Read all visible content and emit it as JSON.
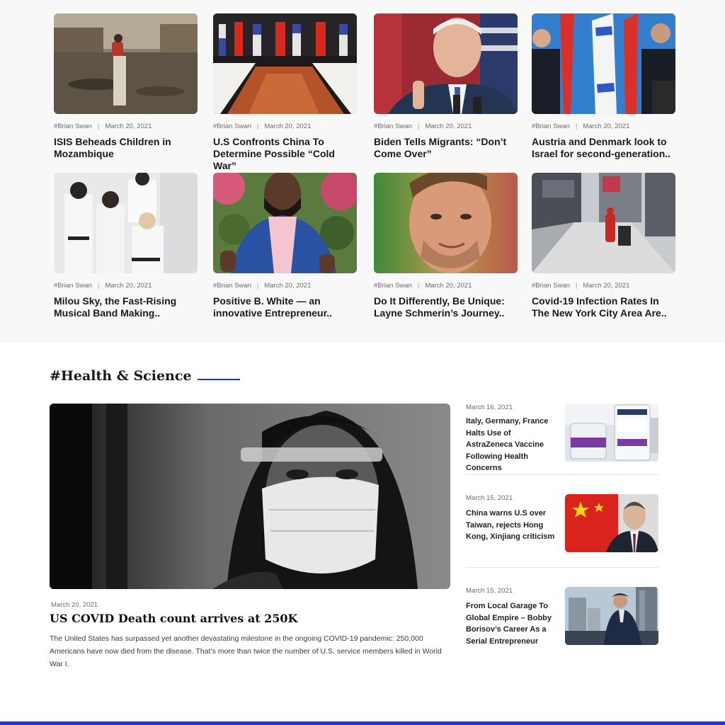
{
  "top_grid": [
    {
      "author": "#Brian Swan",
      "date": "March 20, 2021",
      "title": "ISIS Beheads Children in Mozambique"
    },
    {
      "author": "#Brian Swan",
      "date": "March 20, 2021",
      "title": "U.S Confronts China To Determine Possible “Cold War”"
    },
    {
      "author": "#Brian Swan",
      "date": "March 20, 2021",
      "title": "Biden Tells Migrants: “Don’t Come Over”"
    },
    {
      "author": "#Brian Swan",
      "date": "March 20, 2021",
      "title": "Austria and Denmark look to Israel for second-generation.."
    },
    {
      "author": "#Brian Swan",
      "date": "March 20, 2021",
      "title": "Milou Sky, the Fast-Rising Musical Band Making.."
    },
    {
      "author": "#Brian Swan",
      "date": "March 20, 2021",
      "title": "Positive B. White — an innovative Entrepreneur.."
    },
    {
      "author": "#Brian Swan",
      "date": "March 20, 2021",
      "title": "Do It Differently, Be Unique: Layne Schmerin’s Journey.."
    },
    {
      "author": "#Brian Swan",
      "date": "March 20, 2021",
      "title": "Covid-19 Infection Rates In The New York City Area Are.."
    }
  ],
  "meta_separator": "|",
  "health_section": {
    "heading": "#Health & Science",
    "feature": {
      "date": "March 20, 2021",
      "title": "US COVID Death count arrives at 250K",
      "description": "The United States has surpassed yet another devastating milestone in the ongoing COVID-19 pandemic: 250,000 Americans have now died from the disease. That’s more than twice the number of U.S. service members killed in World War I."
    },
    "side_articles": [
      {
        "date": "March 16, 2021",
        "title": "Italy, Germany, France Halts Use of AstraZeneca Vaccine Following Health Concerns"
      },
      {
        "date": "March 15, 2021",
        "title": "China warns U.S over Taiwan, rejects Hong Kong, Xinjiang criticism"
      },
      {
        "date": "March 15, 2021",
        "title": "From Local Garage To Global Empire – Bobby Borisov’s Career As a Serial Entrepreneur"
      }
    ]
  },
  "colors": {
    "accent": "#1e35d6",
    "section_bg": "#f8f8f9"
  }
}
